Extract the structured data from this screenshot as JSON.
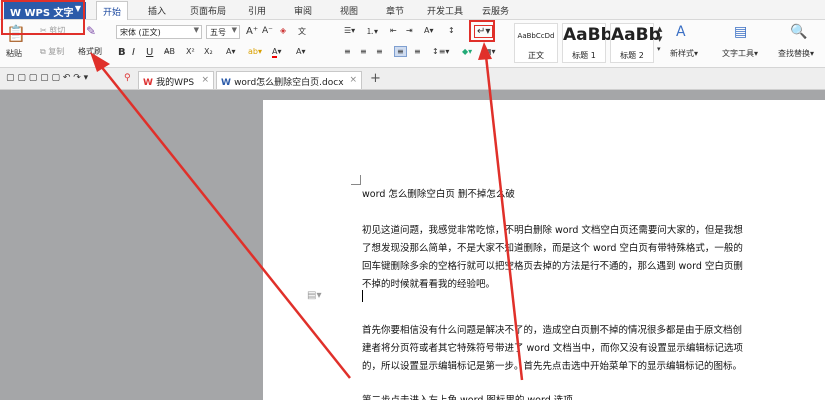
{
  "app": {
    "name": "WPS 文字",
    "menu_tabs": [
      "开始",
      "插入",
      "页面布局",
      "引用",
      "审阅",
      "视图",
      "章节",
      "开发工具",
      "云服务"
    ]
  },
  "ribbon": {
    "clipboard": {
      "cut": "剪切",
      "copy": "复制",
      "paste": "粘贴",
      "format_painter": "格式刷"
    },
    "font": {
      "name": "宋体 (正文)",
      "size": "五号"
    },
    "styles": [
      {
        "sample": "AaBbCcDd",
        "label": "正文"
      },
      {
        "sample": "AaBb",
        "label": "标题 1"
      },
      {
        "sample": "AaBb",
        "label": "标题 2"
      }
    ],
    "new_style": "新样式",
    "text_tools": "文字工具",
    "find_replace": "查找替换"
  },
  "tabs": [
    {
      "label": "我的WPS"
    },
    {
      "label": "word怎么删除空白页.docx"
    }
  ],
  "document": {
    "lines": [
      "word 怎么删除空白页  删不掉怎么破",
      "",
      "初见这道问题，我感觉非常吃惊，不明白删除 word 文档空白页还需要问大家的，但是我想",
      "了想发现没那么简单，不是大家不知道删除，而是这个 word 空白页有带特殊格式，一般的",
      "回车键删除多余的空格行就可以把空格页去掉的方法是行不通的，那么遇到 word 空白页删",
      "不掉的时候就看看我的经验吧。",
      "",
      "",
      "首先你要相信没有什么问题是解决不了的，造成空白页删不掉的情况很多都是由于原文档创",
      "建者将分页符或者其它特殊符号带进了 word 文档当中，而你又没有设置显示编辑标记选项",
      "的，所以设置显示编辑标记是第一步。首先先点击选中开始菜单下的显示编辑标记的图标。",
      "",
      "第二步点击进入左上角 word 图标里的 word 选项"
    ]
  },
  "colors": {
    "annotation": "#e0302a",
    "brand": "#2c5ba9"
  }
}
